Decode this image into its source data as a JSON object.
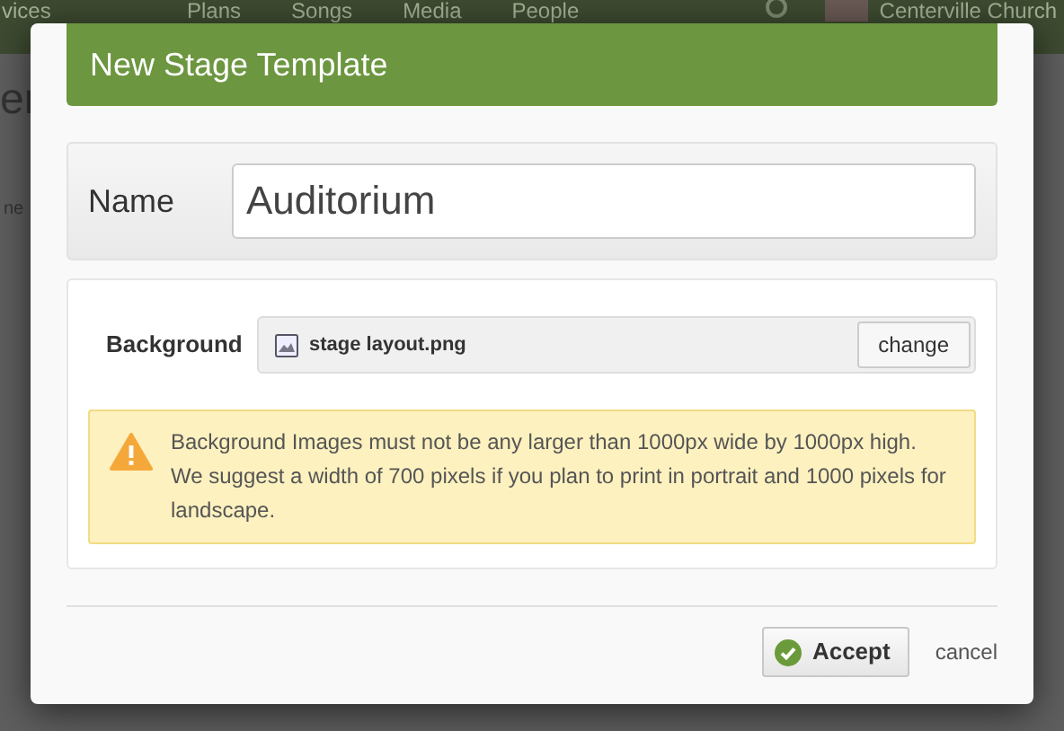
{
  "app_nav": {
    "brand": "vices",
    "items": [
      "Plans",
      "Songs",
      "Media",
      "People"
    ],
    "account": "Centerville Church"
  },
  "background_fragments": [
    "er",
    "ne"
  ],
  "dialog": {
    "title": "New Stage Template",
    "name_field": {
      "label": "Name",
      "value": "Auditorium"
    },
    "background_field": {
      "label": "Background",
      "file": "stage layout.png",
      "button": "change"
    },
    "warning": "Background Images must not be any larger than 1000px wide by 1000px high. We suggest a width of 700 pixels if you plan to print in portrait and 1000 pixels for landscape.",
    "buttons": [
      {
        "kind": "primary",
        "label": "Accept"
      },
      {
        "kind": "link",
        "label": "cancel"
      }
    ]
  }
}
